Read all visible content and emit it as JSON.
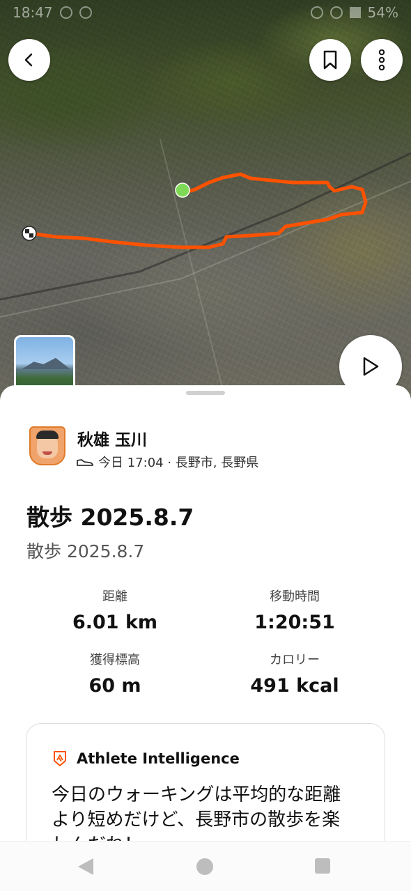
{
  "status_bar": {
    "time": "18:47",
    "battery": "54%"
  },
  "map": {
    "route_color": "#fc5200",
    "start_marker_color": "#7ed957",
    "buttons": {
      "back_icon": "chevron-left-icon",
      "bookmark_icon": "bookmark-icon",
      "more_icon": "more-vertical-icon",
      "play_icon": "play-icon"
    }
  },
  "athlete": {
    "name": "秋雄 玉川",
    "meta": "今日 17:04 · 長野市, 長野県"
  },
  "activity": {
    "title": "散歩 2025.8.7",
    "subtitle": "散歩 2025.8.7"
  },
  "stats": {
    "distance": {
      "label": "距離",
      "value": "6.01 km"
    },
    "moving_time": {
      "label": "移動時間",
      "value": "1:20:51"
    },
    "elevation": {
      "label": "獲得標高",
      "value": "60 m"
    },
    "calories": {
      "label": "カロリー",
      "value": "491 kcal"
    }
  },
  "athlete_intelligence": {
    "title": "Athlete Intelligence",
    "body": "今日のウォーキングは平均的な距離より短めだけど、長野市の散歩を楽しんだね！",
    "accent": "#fc5200"
  }
}
